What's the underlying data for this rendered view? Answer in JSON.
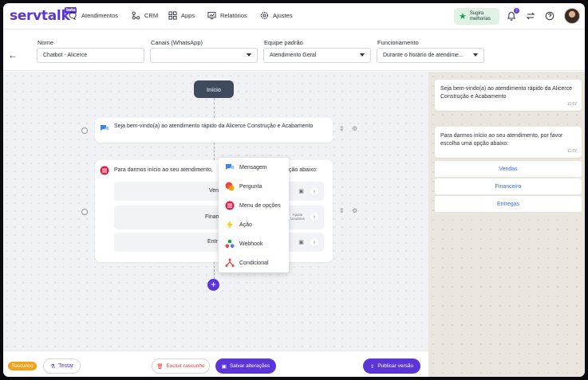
{
  "app": {
    "logo_serv": "serv",
    "logo_talk": "talk",
    "logo_badge": "beta"
  },
  "nav": {
    "items": [
      {
        "label": "Atendimentos",
        "icon": "chat-icon"
      },
      {
        "label": "CRM",
        "icon": "crm-icon"
      },
      {
        "label": "Apps",
        "icon": "apps-grid-icon"
      },
      {
        "label": "Relatórios",
        "icon": "report-icon"
      },
      {
        "label": "Ajustes",
        "icon": "gear-icon"
      }
    ],
    "suggest_line1": "Sugira",
    "suggest_line2": "melhorias",
    "notification_count": "2"
  },
  "form": {
    "name_label": "Nome",
    "name_value": "Chatbot - Alicerce",
    "channels_label": "Canais (WhatsApp)",
    "channels_value": "",
    "team_label": "Equipe padrão",
    "team_value": "Atendimento Geral",
    "schedule_label": "Funcionamento",
    "schedule_value": "Durante o horário de atendime..."
  },
  "flow": {
    "start_label": "Início",
    "node1_text": "Seja bem-vindo(a) ao atendimento rápido da Alicerce Construção e Acabamento",
    "node2_text_left": "Para darmos início ao seu atendimento,",
    "node2_text_right": "ção abaixo:",
    "options": [
      {
        "label": "Ven"
      },
      {
        "label": "Finan",
        "help": "Ajuste Usuários"
      },
      {
        "label": "Entr"
      }
    ],
    "menu": [
      {
        "label": "Mensagem",
        "icon": "message-icon",
        "color": "#3b82f6"
      },
      {
        "label": "Pergunta",
        "icon": "question-icon",
        "color": "#ef4444"
      },
      {
        "label": "Menu de opções",
        "icon": "options-menu-icon",
        "color": "#e11d48"
      },
      {
        "label": "Ação",
        "icon": "lightning-icon",
        "color": "#facc15"
      },
      {
        "label": "Webhook",
        "icon": "webhook-icon",
        "color": "#16a34a"
      },
      {
        "label": "Condicional",
        "icon": "conditional-icon",
        "color": "#ef4444"
      }
    ]
  },
  "preview": {
    "msg1": "Seja bem-vindo(a) ao atendimento rápido da Alicerce Construção e Acabamento",
    "msg1_time": "11:07",
    "msg2": "Para darmos início ao seu atendimento, por favor escolha uma opção abaixo:",
    "msg2_time": "11:07",
    "buttons": [
      "Vendas",
      "Financeiro",
      "Entregas"
    ]
  },
  "footer": {
    "status": "Rascunho",
    "test": "Testar",
    "delete": "Excluir rascunho",
    "save": "Salvar alterações",
    "publish": "Publicar versão"
  },
  "colors": {
    "brand": "#5b35d5",
    "draft": "#f4a21c",
    "danger": "#e53935"
  }
}
